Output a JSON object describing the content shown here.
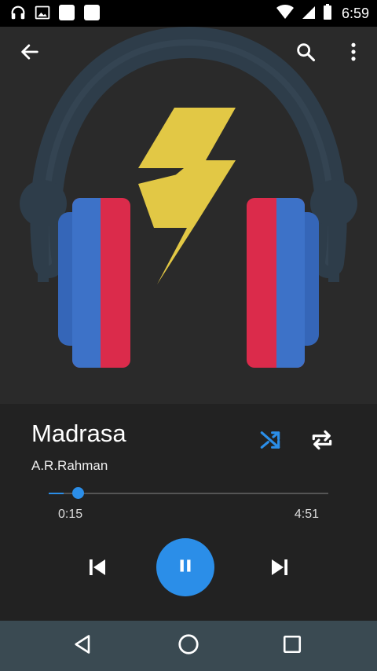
{
  "status_bar": {
    "time": "6:59",
    "left_icons": [
      "headphones-icon",
      "image-icon",
      "notification-square-icon",
      "notification-square-icon"
    ],
    "right_icons": [
      "wifi-icon",
      "signal-icon",
      "battery-icon"
    ]
  },
  "app_bar": {
    "icons": [
      "back-arrow-icon",
      "search-icon",
      "more-vertical-icon"
    ]
  },
  "album_art": {
    "colors": {
      "band": "#2e3d4a",
      "blue": "#3d72c8",
      "red": "#db2b4b",
      "bolt": "#e2c845"
    }
  },
  "track": {
    "title": "Madrasa",
    "artist": "A.R.Rahman"
  },
  "playback": {
    "elapsed": "0:15",
    "duration": "4:51",
    "progress": 0.052,
    "shuffle_active": true,
    "repeat_active": false,
    "state": "playing"
  },
  "colors": {
    "accent": "#2b8ee8",
    "background": "#222222",
    "nav_bar": "#3a4a52"
  },
  "nav_bar": {
    "icons": [
      "back-triangle-icon",
      "home-circle-icon",
      "recents-square-icon"
    ]
  }
}
